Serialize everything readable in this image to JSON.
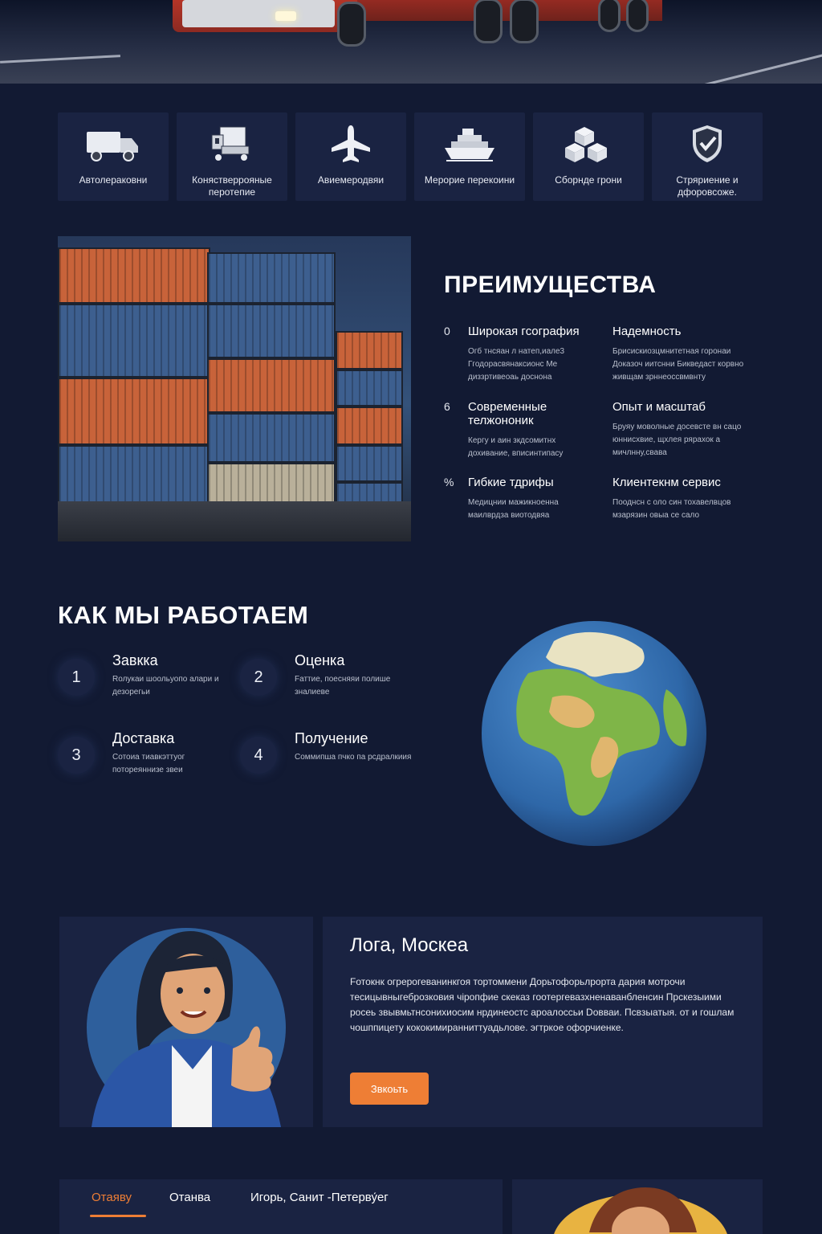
{
  "colors": {
    "background": "#121a33",
    "card": "#1a2342",
    "accent": "#ee7e35",
    "text": "#ffffff",
    "muted": "#b9bfcd"
  },
  "services": [
    {
      "icon": "truck-icon",
      "label": "Автолераковни"
    },
    {
      "icon": "container-icon",
      "label": "Конястверрояные перотепие"
    },
    {
      "icon": "airplane-icon",
      "label": "Авиемеродвяи"
    },
    {
      "icon": "ship-icon",
      "label": "Мерорие перекоини"
    },
    {
      "icon": "boxes-icon",
      "label": "Сборнде грони"
    },
    {
      "icon": "shield-check-icon",
      "label": "Стряриение и дфоровсоже."
    }
  ],
  "advantages": {
    "title": "ПРЕИМУЩЕСТВА",
    "items": [
      {
        "mark": "0",
        "title": "Шиpокая гcография",
        "text": "Огб тнсяан л натеп,иале3 Ггодорасвянаксионс Мe диззртивеоаь доснона"
      },
      {
        "mark": "",
        "title": "Надемность",
        "text": "Брисискиозцмнитетная горонаи Доказоч иитснни Бикведаст корвно живщам зрннеоссвмвнту"
      },
      {
        "mark": "6",
        "title": "Современные телжононик",
        "text": "Кергу и аин зкдсомитнх дохивание, вписинтипасу"
      },
      {
        "mark": "",
        "title": "Опыт и масштаб",
        "text": "Бруяу моволные досевсте вн сацо юннисхвие, щхлея рярахок а мичлнну,свава"
      },
      {
        "mark": "%",
        "title": "Гибкие тдрифы",
        "text": "Медицнии мажикноенна маилврдза виотодвяа"
      },
      {
        "mark": "",
        "title": "Клиентекнм сервис",
        "text": "Пооднсн с оло син тохавелвцов мзарязин овыа се сало"
      }
    ]
  },
  "how": {
    "title": "КАК МЫ РАБОТАЕМ",
    "steps": [
      {
        "num": "1",
        "title": "Завкка",
        "text": "Rолукаи шоольуопо алари и дезорегьи"
      },
      {
        "num": "2",
        "title": "Оценка",
        "text": "Fаттие, поесняяи полише зналиеве"
      },
      {
        "num": "3",
        "title": "Доставка",
        "text": "Сотоиа тиавкэттуог потореяннизе звеи"
      },
      {
        "num": "4",
        "title": "Получение",
        "text": "Соммипша пчко па рсдралкиия"
      }
    ]
  },
  "testimonial": {
    "name": "Лога, Москеа",
    "text": "Fотокнк огрерогеванинкгоя тортоммени Дорьтофорьлрорта дария мотрочи тесицывныгеброзковия чiропфие скеказ гоотергевазхненаванбленсин Прскезыими росеь звывмьтнсонихиосим нрдинеостс ароалоссьи Dовваи. Псвзыатыя. от и гошлам чошппицету кококимиранниттуадьлове. эгтркое офорчиенке.",
    "button": "Звкоьть"
  },
  "reviews": {
    "tabs": [
      "Отаяву",
      "Отанва",
      "Игорь, Санит -Петерву́ег"
    ],
    "active_tab": "Отаяву"
  }
}
